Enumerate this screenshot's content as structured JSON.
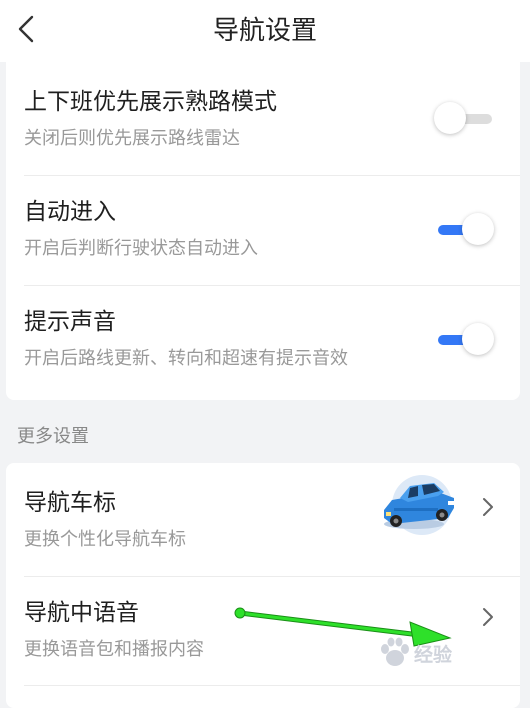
{
  "header": {
    "title": "导航设置"
  },
  "settings": [
    {
      "title": "上下班优先展示熟路模式",
      "subtitle": "关闭后则优先展示路线雷达",
      "enabled": false
    },
    {
      "title": "自动进入",
      "subtitle": "开启后判断行驶状态自动进入",
      "enabled": true
    },
    {
      "title": "提示声音",
      "subtitle": "开启后路线更新、转向和超速有提示音效",
      "enabled": true
    }
  ],
  "more_settings": {
    "section_title": "更多设置",
    "items": [
      {
        "title": "导航车标",
        "subtitle": "更换个性化导航车标"
      },
      {
        "title": "导航中语音",
        "subtitle": "更换语音包和播报内容"
      }
    ]
  },
  "watermark": {
    "text": "经验"
  },
  "colors": {
    "accent": "#3478f6",
    "annotation_arrow": "#2ee02a",
    "car_badge_bg": "#dde9f7"
  },
  "icons": {
    "back": "chevron-left-icon",
    "disclosure": "chevron-right-icon",
    "car": "car-icon",
    "watermark": "baidu-paw-icon"
  }
}
